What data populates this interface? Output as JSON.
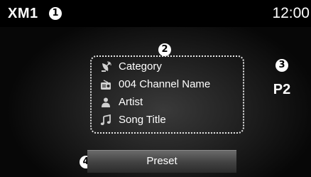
{
  "status_bar": {
    "source": "XM1",
    "clock": "12:00"
  },
  "markers": {
    "m1": "1",
    "m2": "2",
    "m3": "3",
    "m4": "4"
  },
  "info": {
    "rows": [
      {
        "icon": "satellite-dish-icon",
        "text": "Category"
      },
      {
        "icon": "radio-icon",
        "text": "004 Channel Name"
      },
      {
        "icon": "person-icon",
        "text": "Artist"
      },
      {
        "icon": "music-note-icon",
        "text": "Song Title"
      }
    ]
  },
  "preset": {
    "current": "P2",
    "button_label": "Preset"
  },
  "colors": {
    "background": "#1e1e1e",
    "status_bar": "#000000",
    "text": "#ffffff",
    "frame": "#e6e6e6"
  }
}
